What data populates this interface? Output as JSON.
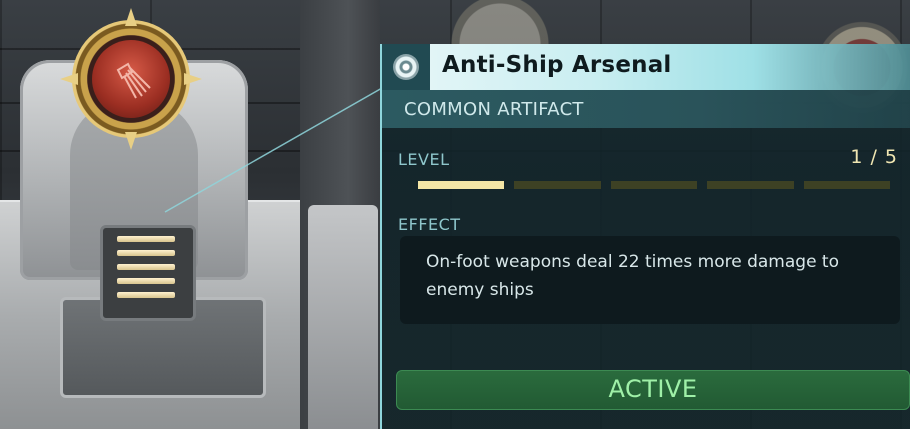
{
  "tooltip": {
    "title": "Anti-Ship Arsenal",
    "rarity": "COMMON ARTIFACT",
    "level_label": "LEVEL",
    "level_value": "1 / 5",
    "level": {
      "current": 1,
      "max": 5
    },
    "effect_label": "EFFECT",
    "effect_text": "On-foot weapons deal 22 times more damage to enemy ships",
    "status": "ACTIVE",
    "icon": "artifact-disc-icon"
  },
  "scene": {
    "artifact_icon": "artifact-emblem-icon"
  },
  "colors": {
    "title_bar": "#c9eef1",
    "rarity_bar": "#2c5a61",
    "level_fill": "#f4e6a6",
    "level_empty": "#3d4124",
    "active_button": "#2a6b3d",
    "active_text": "#9ff0a8",
    "accent": "#8fd6dc"
  }
}
